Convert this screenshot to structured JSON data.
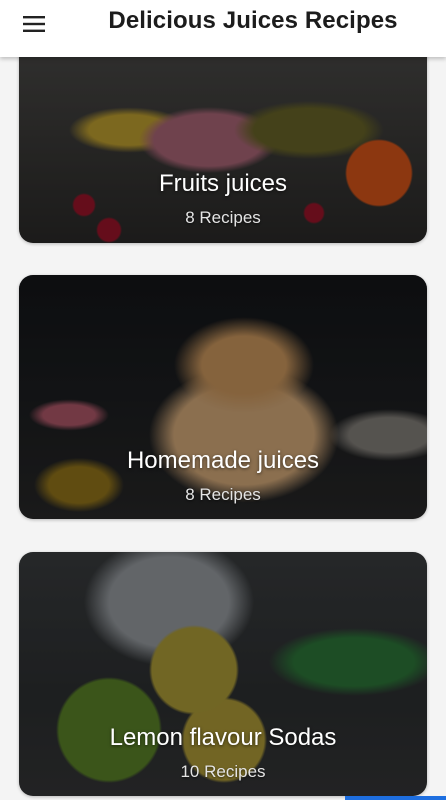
{
  "appbar": {
    "title": "Delicious Juices Recipes",
    "menu_icon": "hamburger-menu-icon"
  },
  "categories": [
    {
      "title": "Fruits juices",
      "count": "8 Recipes"
    },
    {
      "title": "Homemade juices",
      "count": "8 Recipes"
    },
    {
      "title": "Lemon flavour Sodas",
      "count": "10 Recipes"
    }
  ],
  "colors": {
    "appbar_bg": "#ffffff",
    "page_bg": "#f4f4f4",
    "title_text": "#1c1c1c",
    "card_text": "#ffffff"
  }
}
